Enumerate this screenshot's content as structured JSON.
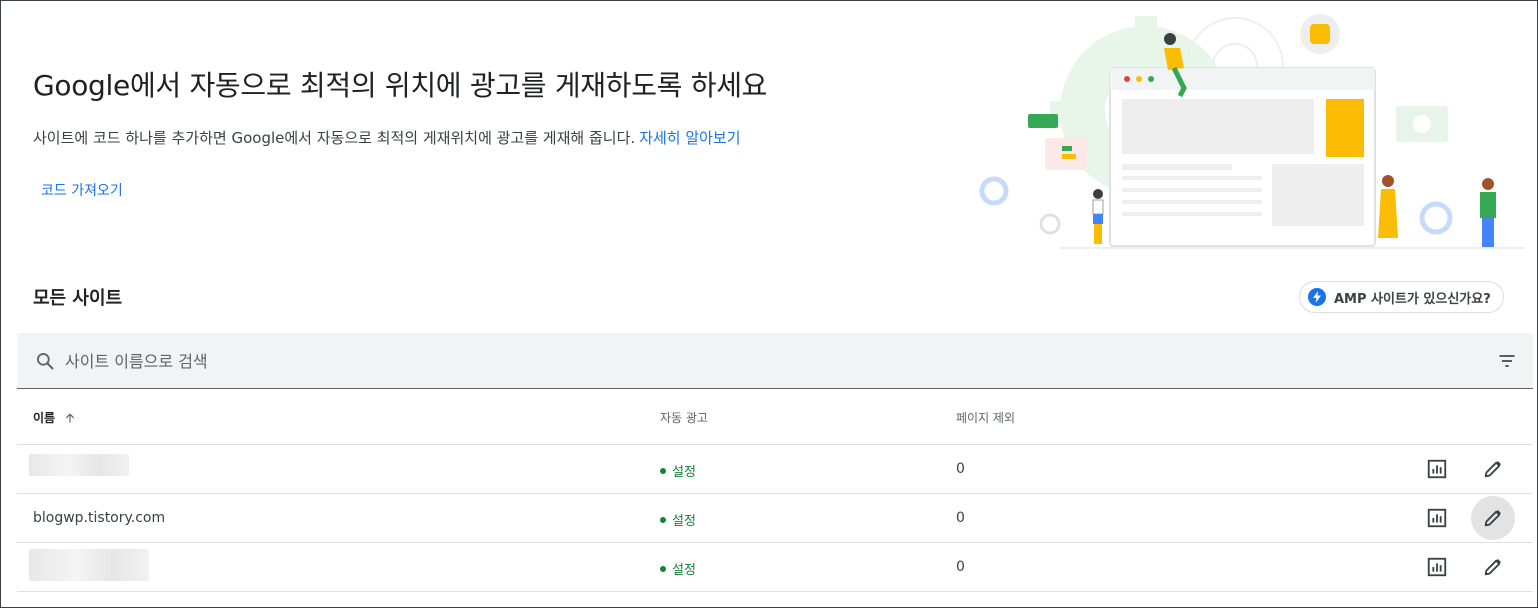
{
  "hero": {
    "title": "Google에서 자동으로 최적의 위치에 광고를 게재하도록 하세요",
    "description": "사이트에 코드 하나를 추가하면 Google에서 자동으로 최적의 게재위치에 광고를 게재해 줍니다.",
    "learn_more": "자세히 알아보기",
    "get_code": "코드 가져오기"
  },
  "sites": {
    "title": "모든 사이트",
    "amp_chip": "AMP 사이트가 있으신가요?",
    "search_placeholder": "사이트 이름으로 검색",
    "columns": {
      "name": "이름",
      "auto_ads": "자동 광고",
      "excluded_pages": "페이지 제외"
    },
    "rows": [
      {
        "name": "",
        "auto_ads": "설정",
        "excluded_pages": "0",
        "name_hidden": true
      },
      {
        "name": "blogwp.tistory.com",
        "auto_ads": "설정",
        "excluded_pages": "0",
        "name_hidden": false
      },
      {
        "name": "",
        "auto_ads": "설정",
        "excluded_pages": "0",
        "name_hidden": true
      }
    ]
  },
  "colors": {
    "link": "#1a73e8",
    "status_on": "#188038",
    "search_bg": "#f1f3f4"
  },
  "icons": {
    "search": "search-icon",
    "filter": "filter-icon",
    "sort": "arrow-up-icon",
    "report": "bar-chart-icon",
    "edit": "pencil-icon",
    "amp": "lightning-icon"
  }
}
